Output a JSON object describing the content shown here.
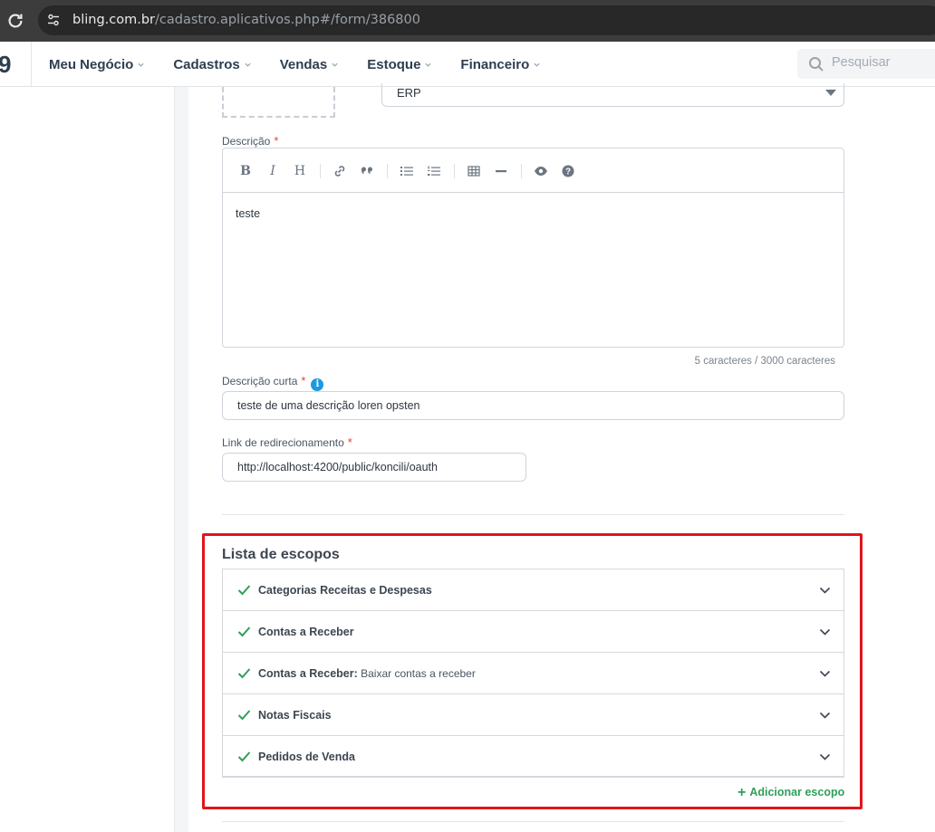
{
  "browser": {
    "url_host": "bling.com.br",
    "url_path": "/cadastro.aplicativos.php#/form/386800"
  },
  "header": {
    "logo_fragment": "9",
    "nav": [
      {
        "label": "Meu Negócio"
      },
      {
        "label": "Cadastros"
      },
      {
        "label": "Vendas"
      },
      {
        "label": "Estoque"
      },
      {
        "label": "Financeiro"
      }
    ],
    "search_placeholder": "Pesquisar"
  },
  "form": {
    "category_select_value": "ERP",
    "description": {
      "label": "Descrição",
      "required_mark": "*",
      "toolbar": [
        "bold-icon",
        "italic-icon",
        "heading-icon",
        "link-icon",
        "quote-icon",
        "bulleted-list-icon",
        "numbered-list-icon",
        "table-icon",
        "horizontal-rule-icon",
        "preview-icon",
        "help-icon"
      ],
      "value": "teste",
      "counter": "5 caracteres / 3000 caracteres"
    },
    "short_description": {
      "label": "Descrição curta",
      "required_mark": "*",
      "value": "teste de uma descrição loren opsten"
    },
    "redirect_link": {
      "label": "Link de redirecionamento",
      "required_mark": "*",
      "value": "http://localhost:4200/public/koncili/oauth"
    }
  },
  "scopes": {
    "title": "Lista de escopos",
    "items": [
      {
        "name": "Categorias Receitas e Despesas",
        "sub": ""
      },
      {
        "name": "Contas a Receber",
        "sub": ""
      },
      {
        "name": "Contas a Receber:",
        "sub": " Baixar contas a receber"
      },
      {
        "name": "Notas Fiscais",
        "sub": ""
      },
      {
        "name": "Pedidos de Venda",
        "sub": ""
      }
    ],
    "add_label": "Adicionar escopo"
  },
  "colors": {
    "highlight": "#e2141c",
    "accent_green": "#2fa05a",
    "info_blue": "#1a9ae0"
  }
}
